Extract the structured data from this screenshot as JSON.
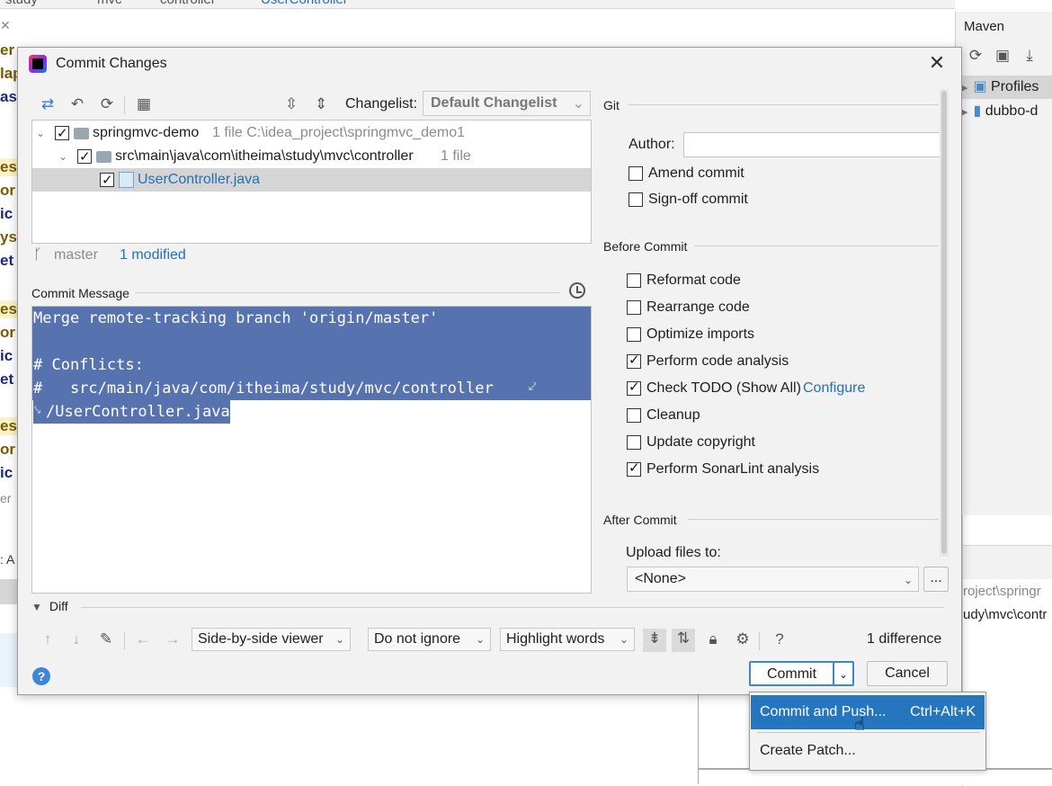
{
  "background": {
    "breadcrumb": [
      "study",
      "mvc",
      "controller",
      "UserController"
    ],
    "left_fragments": [
      "er",
      "lap",
      "as",
      "es",
      "or",
      "ic",
      "ys",
      "et",
      "es",
      "or",
      "ic",
      "et",
      "es",
      "or",
      "ic",
      "er",
      ": A"
    ],
    "maven": {
      "title": "Maven",
      "items": [
        "Profiles",
        "dubbo-d"
      ]
    },
    "right_fragments": [
      "roject\\springr",
      "udy\\mvc\\contr"
    ]
  },
  "dialog": {
    "title": "Commit Changes",
    "changelist_label": "Changelist:",
    "changelist_value": "Default Changelist",
    "tree": [
      {
        "name": "springmvc-demo",
        "meta": "1 file  C:\\idea_project\\springmvc_demo1"
      },
      {
        "name": "src\\main\\java\\com\\itheima\\study\\mvc\\controller",
        "meta": "1 file"
      },
      {
        "name": "UserController.java",
        "meta": ""
      }
    ],
    "branch": "master",
    "modified": "1 modified",
    "commit_message_label": "Commit Message",
    "commit_message_lines": [
      "Merge remote-tracking branch 'origin/master'",
      "",
      "# Conflicts:",
      "#   src/main/java/com/itheima/study/mvc/controller",
      "/UserController.java"
    ],
    "git_section": "Git",
    "author_label": "Author:",
    "author_value": "",
    "git_options": [
      {
        "label": "Amend commit",
        "checked": false
      },
      {
        "label": "Sign-off commit",
        "checked": false
      }
    ],
    "before_commit_section": "Before Commit",
    "before_options": [
      {
        "label": "Reformat code",
        "checked": false
      },
      {
        "label": "Rearrange code",
        "checked": false
      },
      {
        "label": "Optimize imports",
        "checked": false
      },
      {
        "label": "Perform code analysis",
        "checked": true
      },
      {
        "label": "Check TODO (Show All)",
        "checked": true,
        "link": "Configure"
      },
      {
        "label": "Cleanup",
        "checked": false
      },
      {
        "label": "Update copyright",
        "checked": false
      },
      {
        "label": "Perform SonarLint analysis",
        "checked": true
      }
    ],
    "after_commit_section": "After Commit",
    "upload_label": "Upload files to:",
    "upload_value": "<None>",
    "upload_browse": "...",
    "diff": {
      "label": "Diff",
      "viewer": "Side-by-side viewer",
      "ignore": "Do not ignore",
      "highlight": "Highlight words",
      "count": "1 difference"
    },
    "buttons": {
      "commit": "Commit",
      "cancel": "Cancel"
    }
  },
  "popup": {
    "items": [
      {
        "label": "Commit and Push...",
        "shortcut": "Ctrl+Alt+K"
      },
      {
        "label": "Create Patch...",
        "shortcut": ""
      }
    ]
  },
  "colors": {
    "accent": "#2675bf",
    "selection": "#5673b0",
    "link": "#2470b3"
  }
}
